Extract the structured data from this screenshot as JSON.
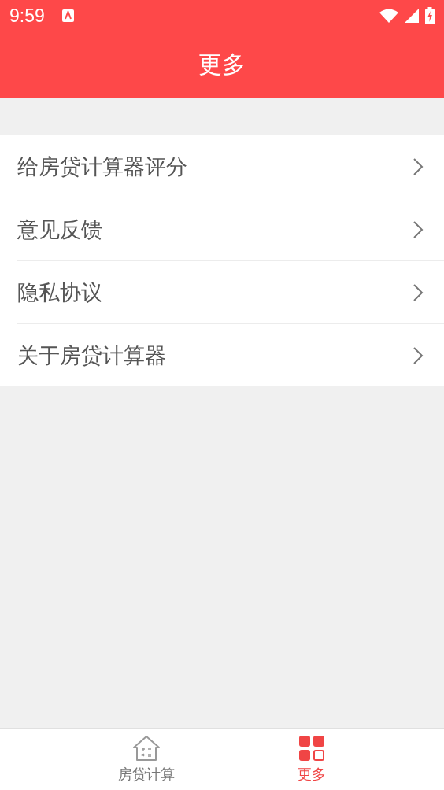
{
  "status_bar": {
    "time": "9:59"
  },
  "header": {
    "title": "更多"
  },
  "menu": {
    "items": [
      {
        "label": "给房贷计算器评分"
      },
      {
        "label": "意见反馈"
      },
      {
        "label": "隐私协议"
      },
      {
        "label": "关于房贷计算器"
      }
    ]
  },
  "bottom_nav": [
    {
      "label": "房贷计算",
      "kind": "house",
      "selected": false
    },
    {
      "label": "更多",
      "kind": "grid",
      "selected": true
    }
  ]
}
